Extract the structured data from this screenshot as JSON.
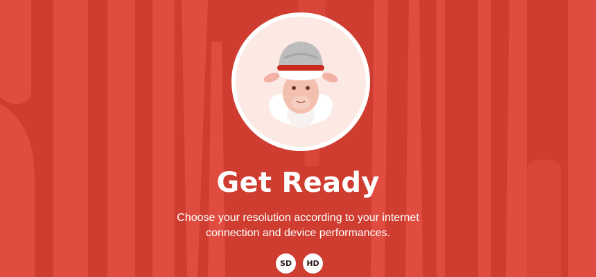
{
  "colors": {
    "background": "#cf3d30",
    "stripe": "#e04d40",
    "avatar_bg": "#fde9e3",
    "ring": "#ffffff",
    "text": "#ffffff"
  },
  "avatar": {
    "icon": "sheep-with-cap-icon"
  },
  "title": "Get Ready",
  "description": "Choose your resolution according to your internet connection and device performances.",
  "resolutions": [
    {
      "label": "SD"
    },
    {
      "label": "HD"
    }
  ]
}
